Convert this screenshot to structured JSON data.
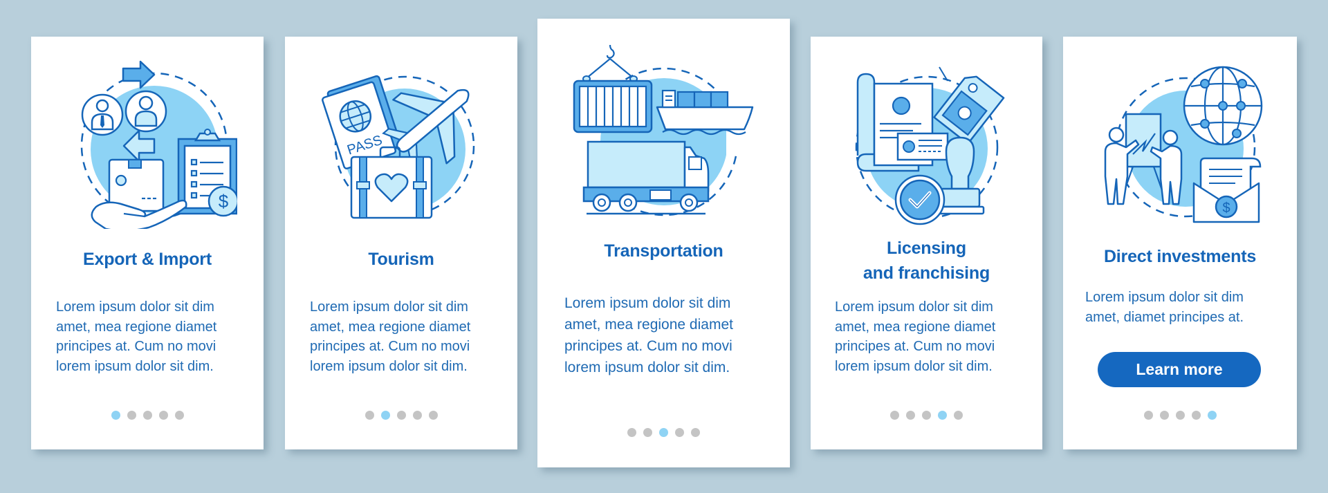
{
  "colors": {
    "background": "#b8cfdb",
    "card": "#ffffff",
    "title": "#1565b8",
    "body_text": "#1f6ab3",
    "accent_dark": "#1568c0",
    "accent_light": "#8dd3f5",
    "dot_inactive": "#c4c4c4",
    "dot_active": "#8fd3f4"
  },
  "screens": [
    {
      "illustration": "export-import-illustration",
      "title_lines": [
        "Export & Import"
      ],
      "body_lines": [
        "Lorem ipsum dolor sit dim",
        "amet, mea regione diamet",
        "principes at. Cum no movi",
        "lorem ipsum dolor sit dim."
      ],
      "page_index": 1,
      "page_count": 5
    },
    {
      "illustration": "tourism-illustration",
      "title_lines": [
        "Tourism"
      ],
      "body_lines": [
        "Lorem ipsum dolor sit dim",
        "amet, mea regione diamet",
        "principes at. Cum no movi",
        "lorem ipsum dolor sit dim."
      ],
      "page_index": 2,
      "page_count": 5,
      "passport_label": "PASS"
    },
    {
      "illustration": "transportation-illustration",
      "title_lines": [
        "Transportation"
      ],
      "body_lines": [
        "Lorem ipsum dolor sit dim",
        "amet, mea regione diamet",
        "principes at. Cum no movi",
        "lorem ipsum dolor sit dim."
      ],
      "page_index": 3,
      "page_count": 5
    },
    {
      "illustration": "licensing-franchising-illustration",
      "title_lines": [
        "Licensing",
        "and franchising"
      ],
      "body_lines": [
        "Lorem ipsum dolor sit dim",
        "amet, mea regione diamet",
        "principes at. Cum no movi",
        "lorem ipsum dolor sit dim."
      ],
      "page_index": 4,
      "page_count": 5
    },
    {
      "illustration": "direct-investments-illustration",
      "title_lines": [
        "Direct investments"
      ],
      "body_lines": [
        "Lorem ipsum dolor sit dim",
        "amet, diamet principes at."
      ],
      "page_index": 5,
      "page_count": 5,
      "button_label": "Learn more",
      "dollar_sign": "$"
    }
  ],
  "export_dollar_sign": "$"
}
